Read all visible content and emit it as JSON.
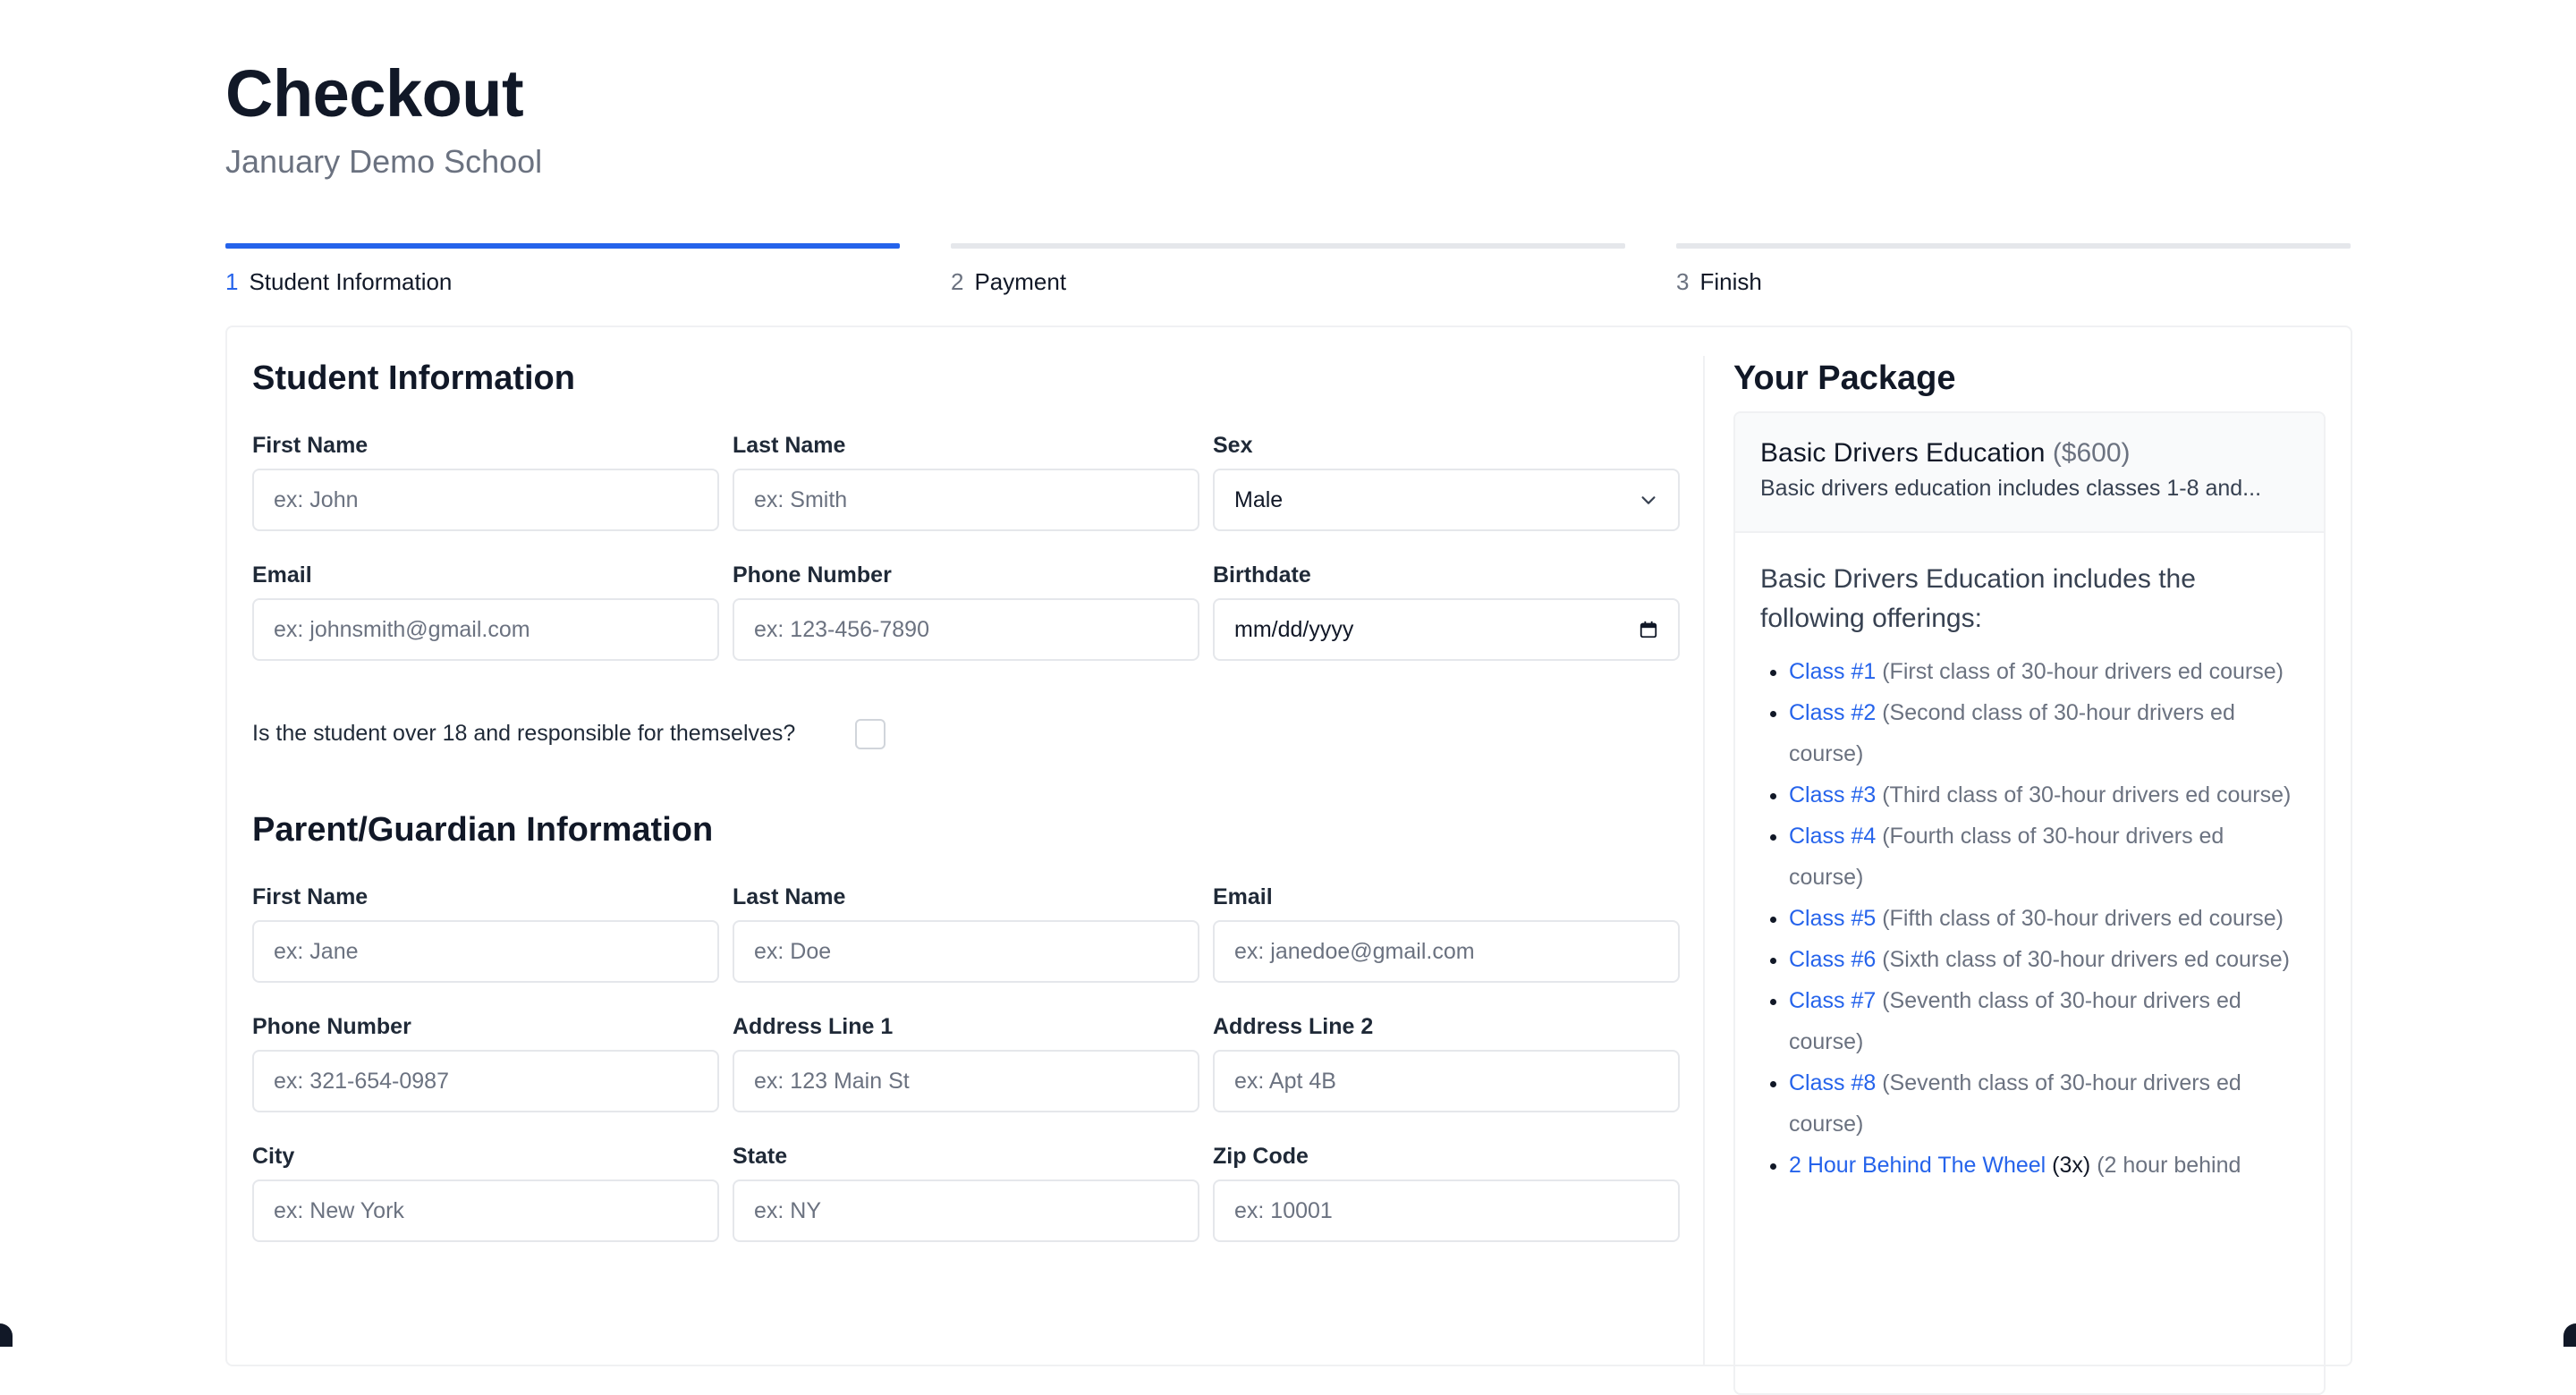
{
  "page": {
    "title": "Checkout",
    "subtitle": "January Demo School"
  },
  "steps": [
    {
      "num": "1",
      "label": "Student Information",
      "active": true
    },
    {
      "num": "2",
      "label": "Payment",
      "active": false
    },
    {
      "num": "3",
      "label": "Finish",
      "active": false
    }
  ],
  "student": {
    "heading": "Student Information",
    "first_name": {
      "label": "First Name",
      "placeholder": "ex: John"
    },
    "last_name": {
      "label": "Last Name",
      "placeholder": "ex: Smith"
    },
    "sex": {
      "label": "Sex",
      "value": "Male"
    },
    "email": {
      "label": "Email",
      "placeholder": "ex: johnsmith@gmail.com"
    },
    "phone": {
      "label": "Phone Number",
      "placeholder": "ex: 123-456-7890"
    },
    "birthdate": {
      "label": "Birthdate",
      "value": "mm/dd/yyyy"
    },
    "adult_question": "Is the student over 18 and responsible for themselves?"
  },
  "guardian": {
    "heading": "Parent/Guardian Information",
    "first_name": {
      "label": "First Name",
      "placeholder": "ex: Jane"
    },
    "last_name": {
      "label": "Last Name",
      "placeholder": "ex: Doe"
    },
    "email": {
      "label": "Email",
      "placeholder": "ex: janedoe@gmail.com"
    },
    "phone": {
      "label": "Phone Number",
      "placeholder": "ex: 321-654-0987"
    },
    "address1": {
      "label": "Address Line 1",
      "placeholder": "ex: 123 Main St"
    },
    "address2": {
      "label": "Address Line 2",
      "placeholder": "ex: Apt 4B"
    },
    "city": {
      "label": "City",
      "placeholder": "ex: New York"
    },
    "state": {
      "label": "State",
      "placeholder": "ex: NY"
    },
    "zip": {
      "label": "Zip Code",
      "placeholder": "ex: 10001"
    }
  },
  "package": {
    "heading": "Your Package",
    "name": "Basic Drivers Education",
    "price": "($600)",
    "description": "Basic drivers education includes classes 1-8 and...",
    "intro": "Basic Drivers Education includes the following offerings:",
    "offerings": [
      {
        "link": "Class #1",
        "qty": "",
        "desc": "(First class of 30-hour drivers ed course)"
      },
      {
        "link": "Class #2",
        "qty": "",
        "desc": "(Second class of 30-hour drivers ed course)"
      },
      {
        "link": "Class #3",
        "qty": "",
        "desc": "(Third class of 30-hour drivers ed course)"
      },
      {
        "link": "Class #4",
        "qty": "",
        "desc": "(Fourth class of 30-hour drivers ed course)"
      },
      {
        "link": "Class #5",
        "qty": "",
        "desc": "(Fifth class of 30-hour drivers ed course)"
      },
      {
        "link": "Class #6",
        "qty": "",
        "desc": "(Sixth class of 30-hour drivers ed course)"
      },
      {
        "link": "Class #7",
        "qty": "",
        "desc": "(Seventh class of 30-hour drivers ed course)"
      },
      {
        "link": "Class #8",
        "qty": "",
        "desc": "(Seventh class of 30-hour drivers ed course)"
      },
      {
        "link": "2 Hour Behind The Wheel",
        "qty": "(3x)",
        "desc": "(2 hour behind"
      }
    ]
  },
  "colors": {
    "accent": "#2563eb",
    "text": "#111827",
    "muted": "#6b7280",
    "border": "#e5e7eb"
  }
}
